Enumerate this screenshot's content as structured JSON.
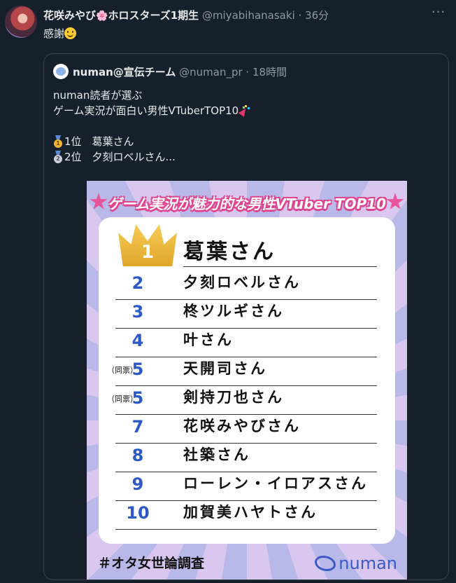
{
  "tweet": {
    "display_name": "花咲みやび",
    "display_name_suffix": "ホロスターズ1期生",
    "handle": "@miyabihanasaki",
    "dot": "·",
    "time": "36分",
    "text": "感謝"
  },
  "quote": {
    "display_name": "numan@宣伝チーム",
    "handle": "@numan_pr",
    "dot": "·",
    "time": "18時間",
    "lines": [
      "numan読者が選ぶ",
      "ゲーム実況が面白い男性VTuberTOP10",
      "1位　葛葉さん",
      "2位　夕刻ロベルさん..."
    ]
  },
  "ranking": {
    "title": "ゲーム実況が魅力的な男性VTuber TOP10",
    "first": {
      "rank": "1",
      "name": "葛葉さん"
    },
    "rows": [
      {
        "rank": "2",
        "name": "夕刻ロベルさん",
        "tie": ""
      },
      {
        "rank": "3",
        "name": "柊ツルギさん",
        "tie": ""
      },
      {
        "rank": "4",
        "name": "叶さん",
        "tie": ""
      },
      {
        "rank": "5",
        "name": "天開司さん",
        "tie": "（同票）"
      },
      {
        "rank": "5",
        "name": "剣持刀也さん",
        "tie": "（同票）"
      },
      {
        "rank": "7",
        "name": "花咲みやびさん",
        "tie": ""
      },
      {
        "rank": "8",
        "name": "社築さん",
        "tie": ""
      },
      {
        "rank": "9",
        "name": "ローレン・イロアスさん",
        "tie": ""
      },
      {
        "rank": "10",
        "name": "加賀美ハヤトさん",
        "tie": ""
      }
    ],
    "hashtag": "＃オタ女世論調査",
    "brand": "numan"
  },
  "colors": {
    "background": "#15202b",
    "rank_number": "#2d58c7",
    "banner_pink": "#e0458f"
  },
  "icons": [
    "more-icon",
    "flower-icon",
    "smile-icon",
    "party-icon",
    "gold-medal-icon",
    "silver-medal-icon",
    "crown-icon",
    "star-icon"
  ]
}
